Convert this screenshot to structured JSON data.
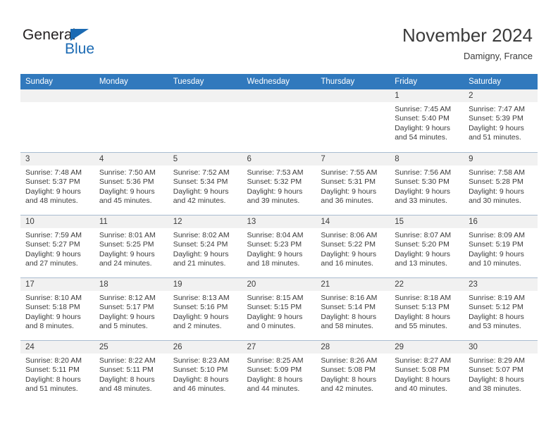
{
  "brand": {
    "word_one": "General",
    "word_two": "Blue",
    "triangle_icon": "blue-triangle-icon",
    "accent_color": "#1b6ab3"
  },
  "header": {
    "title": "November 2024",
    "subtitle": "Damigny, France"
  },
  "theme": {
    "header_bg": "#3179bd",
    "daynum_bg": "#f1f1f1",
    "grid_line": "#a9bcd0",
    "text": "#3b3b3b"
  },
  "calendar": {
    "weekday_headers": [
      "Sunday",
      "Monday",
      "Tuesday",
      "Wednesday",
      "Thursday",
      "Friday",
      "Saturday"
    ],
    "weeks": [
      [
        {
          "day": "",
          "details": ""
        },
        {
          "day": "",
          "details": ""
        },
        {
          "day": "",
          "details": ""
        },
        {
          "day": "",
          "details": ""
        },
        {
          "day": "",
          "details": ""
        },
        {
          "day": "1",
          "details": "Sunrise: 7:45 AM\nSunset: 5:40 PM\nDaylight: 9 hours\nand 54 minutes."
        },
        {
          "day": "2",
          "details": "Sunrise: 7:47 AM\nSunset: 5:39 PM\nDaylight: 9 hours\nand 51 minutes."
        }
      ],
      [
        {
          "day": "3",
          "details": "Sunrise: 7:48 AM\nSunset: 5:37 PM\nDaylight: 9 hours\nand 48 minutes."
        },
        {
          "day": "4",
          "details": "Sunrise: 7:50 AM\nSunset: 5:36 PM\nDaylight: 9 hours\nand 45 minutes."
        },
        {
          "day": "5",
          "details": "Sunrise: 7:52 AM\nSunset: 5:34 PM\nDaylight: 9 hours\nand 42 minutes."
        },
        {
          "day": "6",
          "details": "Sunrise: 7:53 AM\nSunset: 5:32 PM\nDaylight: 9 hours\nand 39 minutes."
        },
        {
          "day": "7",
          "details": "Sunrise: 7:55 AM\nSunset: 5:31 PM\nDaylight: 9 hours\nand 36 minutes."
        },
        {
          "day": "8",
          "details": "Sunrise: 7:56 AM\nSunset: 5:30 PM\nDaylight: 9 hours\nand 33 minutes."
        },
        {
          "day": "9",
          "details": "Sunrise: 7:58 AM\nSunset: 5:28 PM\nDaylight: 9 hours\nand 30 minutes."
        }
      ],
      [
        {
          "day": "10",
          "details": "Sunrise: 7:59 AM\nSunset: 5:27 PM\nDaylight: 9 hours\nand 27 minutes."
        },
        {
          "day": "11",
          "details": "Sunrise: 8:01 AM\nSunset: 5:25 PM\nDaylight: 9 hours\nand 24 minutes."
        },
        {
          "day": "12",
          "details": "Sunrise: 8:02 AM\nSunset: 5:24 PM\nDaylight: 9 hours\nand 21 minutes."
        },
        {
          "day": "13",
          "details": "Sunrise: 8:04 AM\nSunset: 5:23 PM\nDaylight: 9 hours\nand 18 minutes."
        },
        {
          "day": "14",
          "details": "Sunrise: 8:06 AM\nSunset: 5:22 PM\nDaylight: 9 hours\nand 16 minutes."
        },
        {
          "day": "15",
          "details": "Sunrise: 8:07 AM\nSunset: 5:20 PM\nDaylight: 9 hours\nand 13 minutes."
        },
        {
          "day": "16",
          "details": "Sunrise: 8:09 AM\nSunset: 5:19 PM\nDaylight: 9 hours\nand 10 minutes."
        }
      ],
      [
        {
          "day": "17",
          "details": "Sunrise: 8:10 AM\nSunset: 5:18 PM\nDaylight: 9 hours\nand 8 minutes."
        },
        {
          "day": "18",
          "details": "Sunrise: 8:12 AM\nSunset: 5:17 PM\nDaylight: 9 hours\nand 5 minutes."
        },
        {
          "day": "19",
          "details": "Sunrise: 8:13 AM\nSunset: 5:16 PM\nDaylight: 9 hours\nand 2 minutes."
        },
        {
          "day": "20",
          "details": "Sunrise: 8:15 AM\nSunset: 5:15 PM\nDaylight: 9 hours\nand 0 minutes."
        },
        {
          "day": "21",
          "details": "Sunrise: 8:16 AM\nSunset: 5:14 PM\nDaylight: 8 hours\nand 58 minutes."
        },
        {
          "day": "22",
          "details": "Sunrise: 8:18 AM\nSunset: 5:13 PM\nDaylight: 8 hours\nand 55 minutes."
        },
        {
          "day": "23",
          "details": "Sunrise: 8:19 AM\nSunset: 5:12 PM\nDaylight: 8 hours\nand 53 minutes."
        }
      ],
      [
        {
          "day": "24",
          "details": "Sunrise: 8:20 AM\nSunset: 5:11 PM\nDaylight: 8 hours\nand 51 minutes."
        },
        {
          "day": "25",
          "details": "Sunrise: 8:22 AM\nSunset: 5:11 PM\nDaylight: 8 hours\nand 48 minutes."
        },
        {
          "day": "26",
          "details": "Sunrise: 8:23 AM\nSunset: 5:10 PM\nDaylight: 8 hours\nand 46 minutes."
        },
        {
          "day": "27",
          "details": "Sunrise: 8:25 AM\nSunset: 5:09 PM\nDaylight: 8 hours\nand 44 minutes."
        },
        {
          "day": "28",
          "details": "Sunrise: 8:26 AM\nSunset: 5:08 PM\nDaylight: 8 hours\nand 42 minutes."
        },
        {
          "day": "29",
          "details": "Sunrise: 8:27 AM\nSunset: 5:08 PM\nDaylight: 8 hours\nand 40 minutes."
        },
        {
          "day": "30",
          "details": "Sunrise: 8:29 AM\nSunset: 5:07 PM\nDaylight: 8 hours\nand 38 minutes."
        }
      ]
    ]
  }
}
